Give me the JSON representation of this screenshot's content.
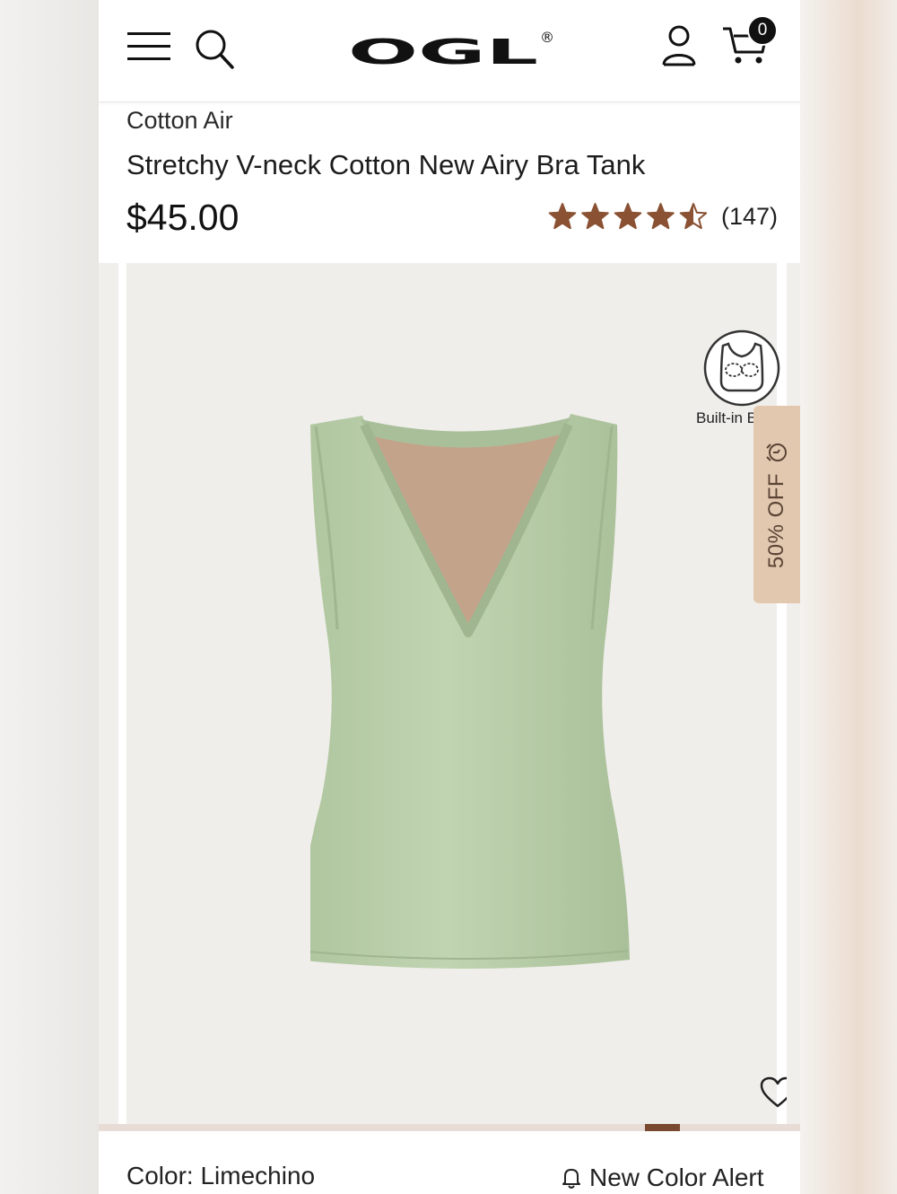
{
  "header": {
    "brand": "OGL",
    "registered_mark": "®",
    "cart_count": "0",
    "icons": [
      "menu-icon",
      "search-icon",
      "account-icon",
      "cart-icon"
    ]
  },
  "product": {
    "collection": "Cotton Air",
    "title": "Stretchy V-neck Cotton New Airy Bra Tank",
    "price": "$45.00",
    "rating": 4.5,
    "rating_max": 5,
    "review_count": "(147)"
  },
  "gallery": {
    "badge_label": "Built-in Bra",
    "sale_tab": "50% OFF",
    "wishlist_icon": "heart-icon"
  },
  "options": {
    "color_label": "Color: Limechino",
    "alert_label": "New Color Alert"
  },
  "colors": {
    "star": "#8a5233",
    "product": "#b9cfa9",
    "sale_tab": "#e3c8b0",
    "indicator": "#7a4a30"
  }
}
